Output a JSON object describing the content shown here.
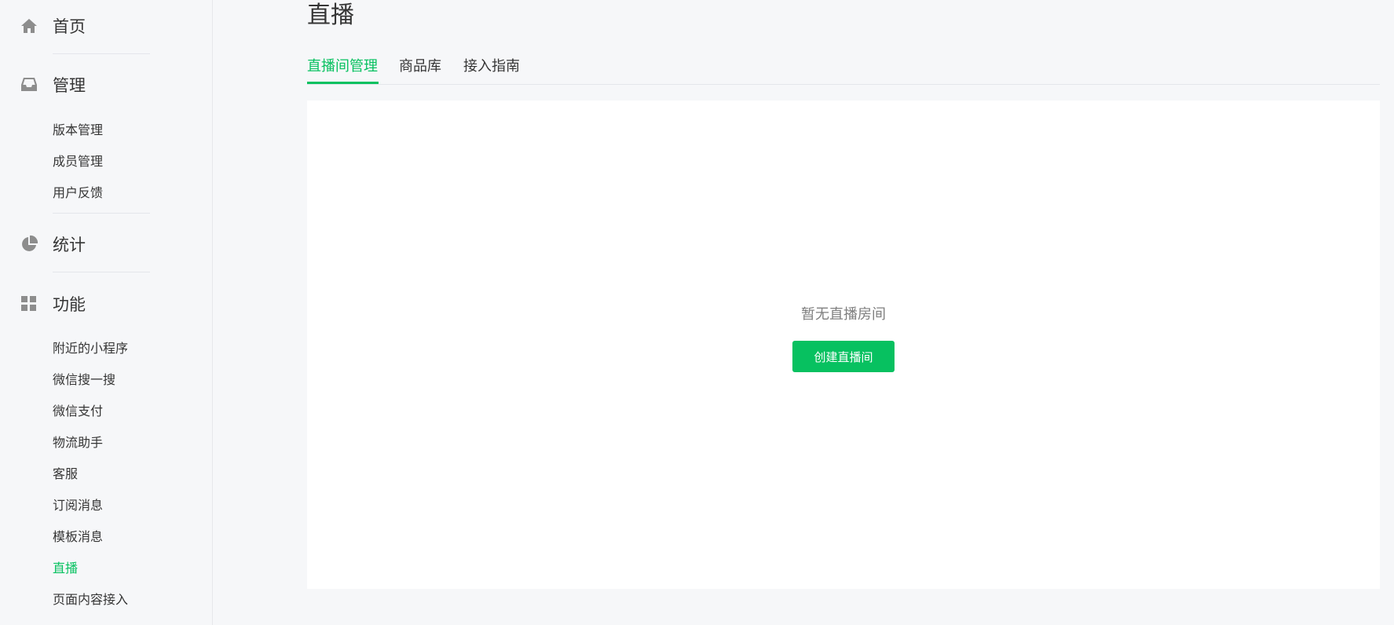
{
  "sidebar": {
    "home": {
      "label": "首页",
      "icon": "home-icon"
    },
    "manage": {
      "label": "管理",
      "icon": "inbox-icon",
      "items": [
        "版本管理",
        "成员管理",
        "用户反馈"
      ]
    },
    "stats": {
      "label": "统计",
      "icon": "pie-chart-icon"
    },
    "features": {
      "label": "功能",
      "icon": "grid-icon",
      "items": [
        "附近的小程序",
        "微信搜一搜",
        "微信支付",
        "物流助手",
        "客服",
        "订阅消息",
        "模板消息",
        "直播",
        "页面内容接入"
      ],
      "active_item": "直播"
    }
  },
  "main": {
    "title": "直播",
    "tabs": [
      "直播间管理",
      "商品库",
      "接入指南"
    ],
    "active_tab": "直播间管理",
    "empty_text": "暂无直播房间",
    "create_button_label": "创建直播间"
  },
  "colors": {
    "accent": "#07c160",
    "text": "#353535",
    "icon": "#8d8d8d",
    "muted_text": "#7f7f7f",
    "background": "#f6f7f9"
  }
}
